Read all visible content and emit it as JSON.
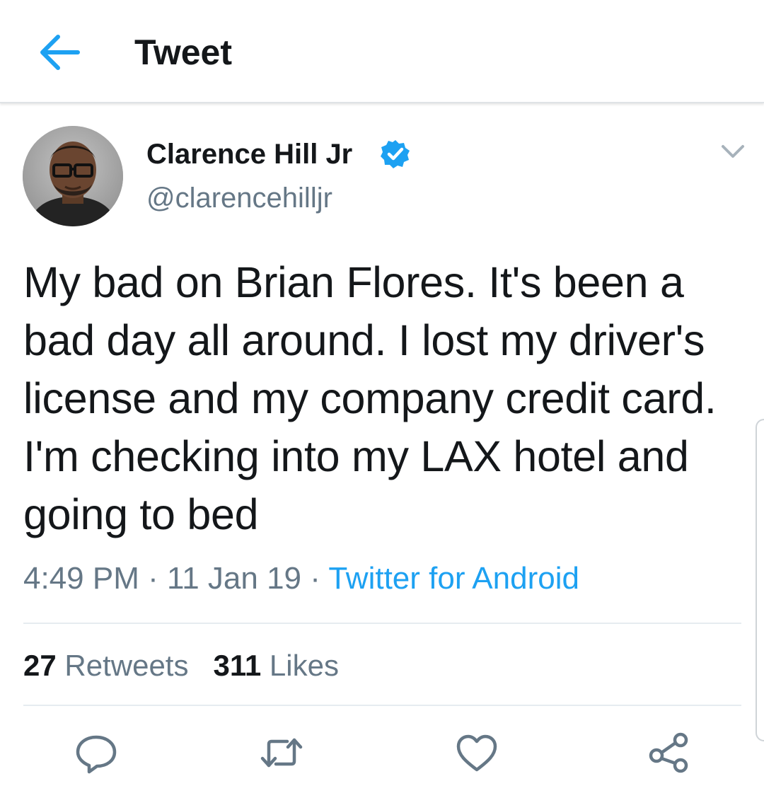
{
  "header": {
    "title": "Tweet",
    "back_icon": "arrow-left-icon",
    "accent_color": "#1da1f2"
  },
  "author": {
    "display_name": "Clarence Hill Jr",
    "handle": "@clarencehilljr",
    "verified": true,
    "verified_icon": "verified-badge-icon"
  },
  "tweet": {
    "text": "My bad on Brian Flores. It's been a bad day all around. I lost my driver's license and my company credit card. I'm checking into my LAX hotel and going to bed",
    "time": "4:49 PM",
    "date": "11 Jan 19",
    "separator": "·",
    "source": "Twitter for Android"
  },
  "stats": {
    "retweets_count": "27",
    "retweets_label": "Retweets",
    "likes_count": "311",
    "likes_label": "Likes"
  },
  "actions": [
    {
      "icon": "reply-icon"
    },
    {
      "icon": "retweet-icon"
    },
    {
      "icon": "like-icon"
    },
    {
      "icon": "share-icon"
    }
  ],
  "colors": {
    "text_primary": "#14171a",
    "text_secondary": "#657786",
    "link": "#1da1f2",
    "divider": "#e6ecf0"
  }
}
